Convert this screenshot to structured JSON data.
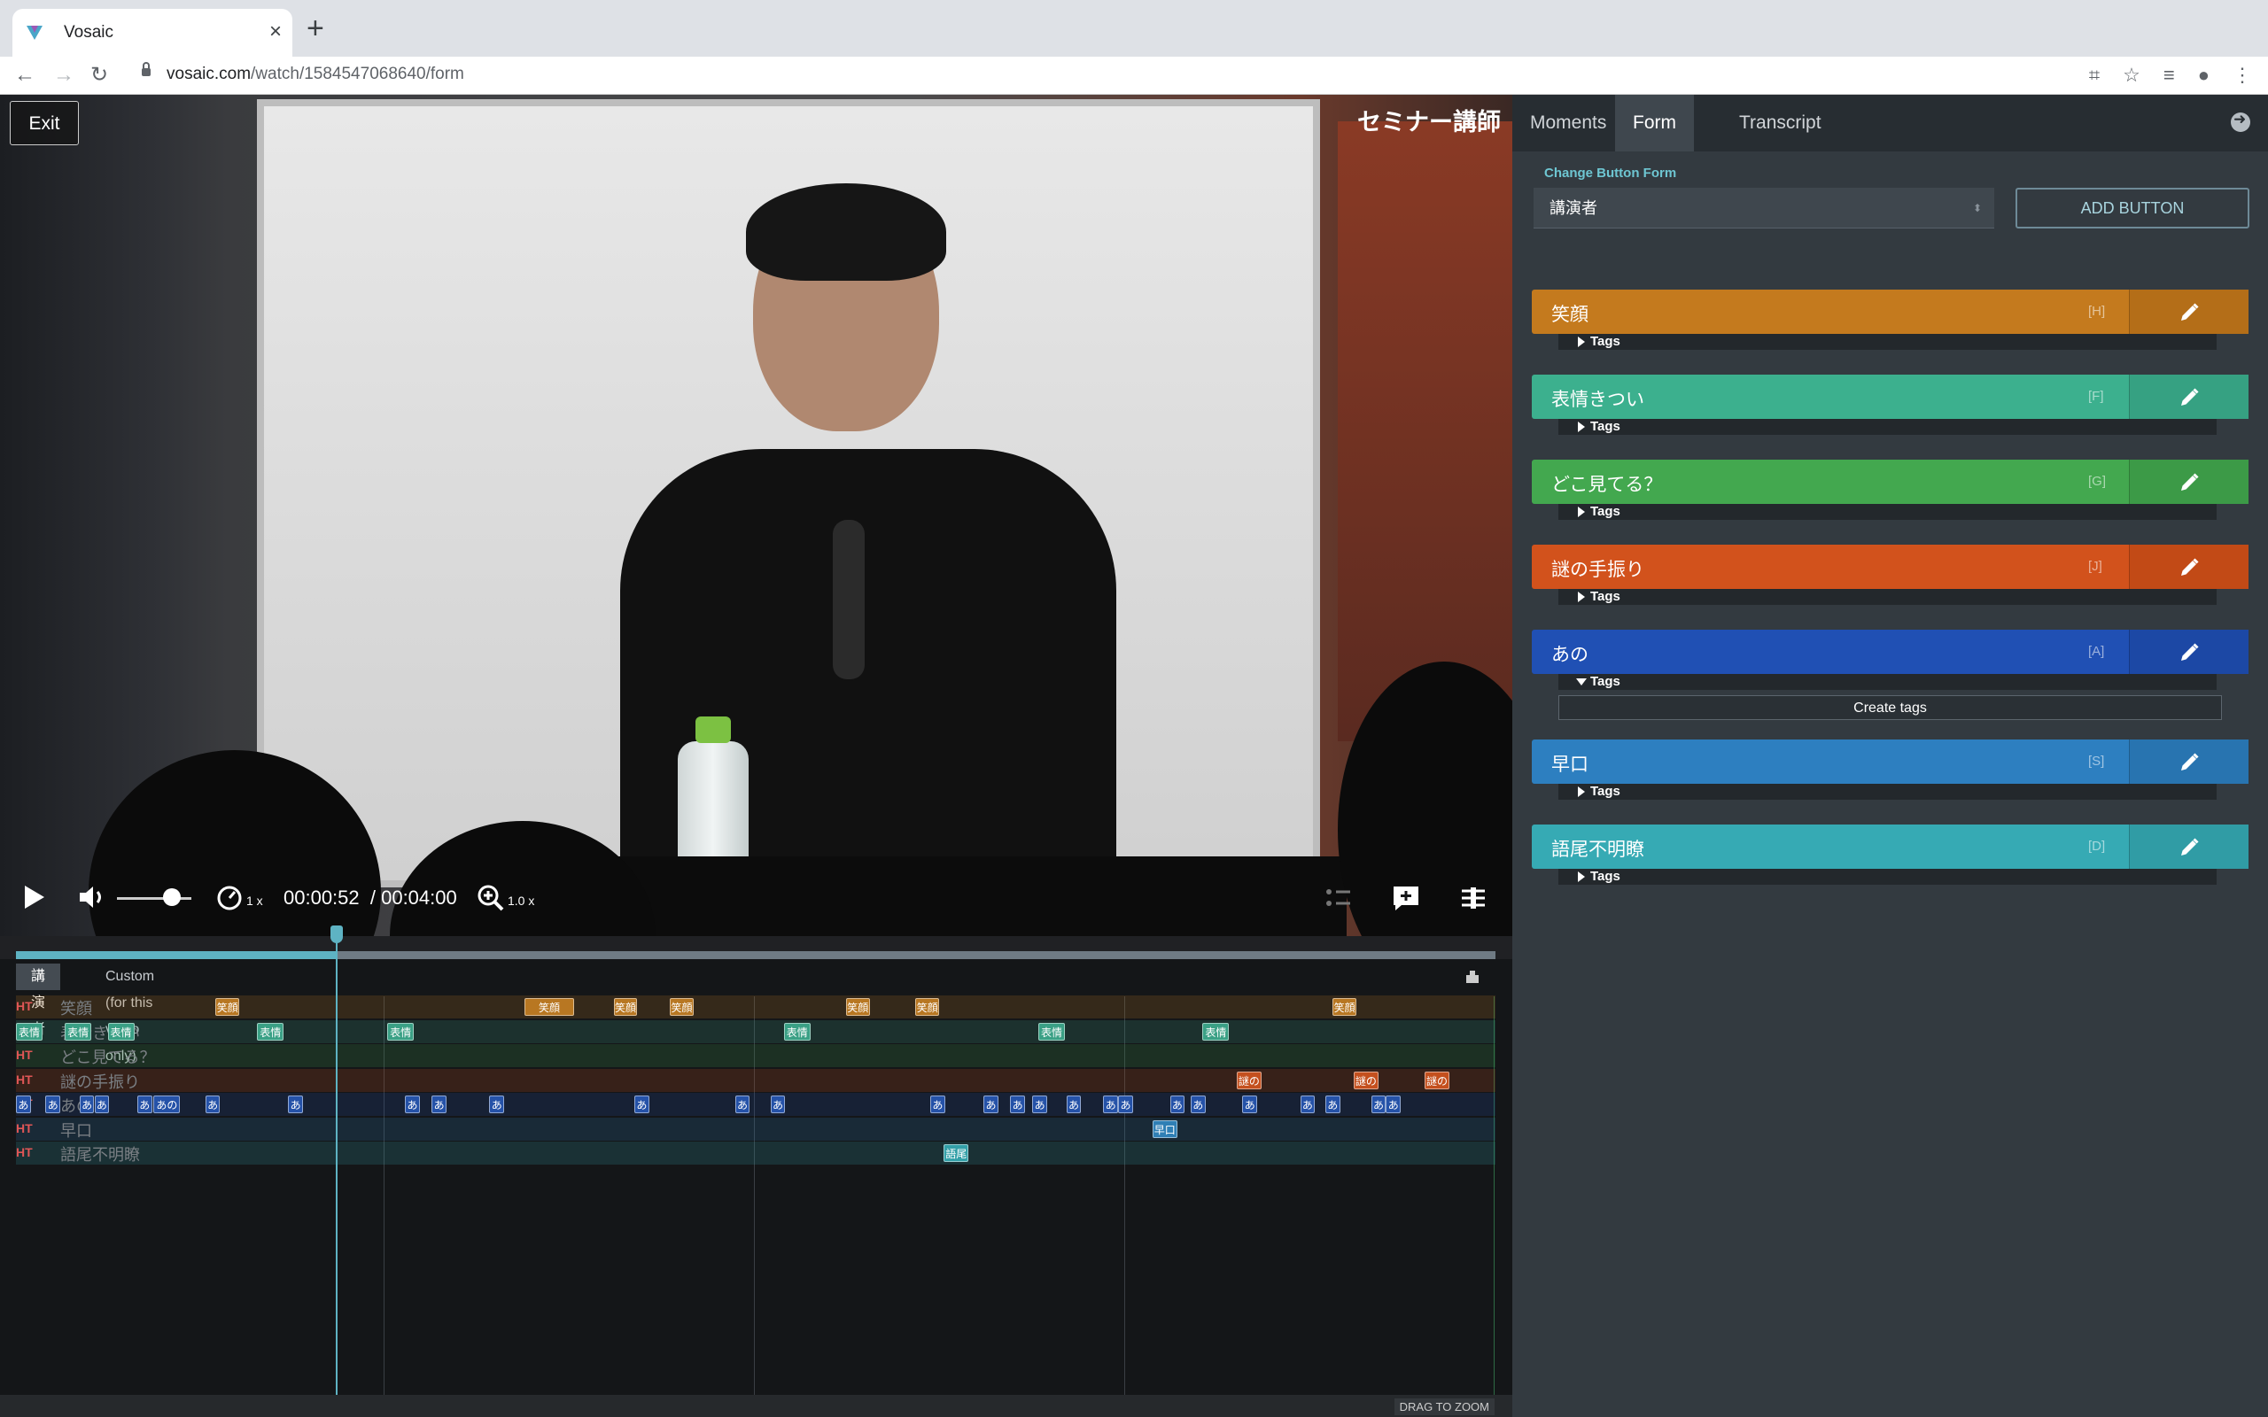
{
  "browser": {
    "tab_title": "Vosaic",
    "url_host": "vosaic.com",
    "url_path": "/watch/1584547068640/form"
  },
  "video": {
    "exit_label": "Exit",
    "overlay_title": "セミナー講師",
    "current_time": "00:00:52",
    "total_time": "/ 00:04:00",
    "rate_label": "1 x",
    "zoom_label": "1.0 x",
    "progress_fraction": 0.217,
    "volume_fraction": 0.62
  },
  "timeline": {
    "tab_selected": "講演者",
    "tab_other": "Custom (for this video only)",
    "drag_to_zoom": "DRAG TO ZOOM",
    "rows": [
      {
        "ht": "HT",
        "name": "笑顔",
        "color": "#b87722",
        "events": [
          {
            "x": 0.135,
            "w": 0.016,
            "t": "笑顔"
          },
          {
            "x": 0.344,
            "w": 0.033,
            "t": "笑顔"
          },
          {
            "x": 0.404,
            "w": 0.016,
            "t": "笑顔"
          },
          {
            "x": 0.442,
            "w": 0.016,
            "t": "笑顔"
          },
          {
            "x": 0.561,
            "w": 0.016,
            "t": "笑顔"
          },
          {
            "x": 0.608,
            "w": 0.016,
            "t": "笑顔"
          },
          {
            "x": 0.89,
            "w": 0.016,
            "t": "笑顔"
          }
        ]
      },
      {
        "ht": "HT",
        "name": "表情きつい",
        "color": "#3aa085",
        "events": [
          {
            "x": 0.0,
            "w": 0.018,
            "t": "表情"
          },
          {
            "x": 0.033,
            "w": 0.018,
            "t": "表情"
          },
          {
            "x": 0.062,
            "w": 0.018,
            "t": "表情"
          },
          {
            "x": 0.163,
            "w": 0.018,
            "t": "表情"
          },
          {
            "x": 0.251,
            "w": 0.018,
            "t": "表情"
          },
          {
            "x": 0.519,
            "w": 0.018,
            "t": "表情"
          },
          {
            "x": 0.691,
            "w": 0.018,
            "t": "表情"
          },
          {
            "x": 0.802,
            "w": 0.018,
            "t": "表情"
          }
        ]
      },
      {
        "ht": "HT",
        "name": "どこ見てる？",
        "color": "#3e9a4e",
        "events": []
      },
      {
        "ht": "HT",
        "name": "謎の手振り",
        "color": "#c4501e",
        "events": [
          {
            "x": 0.825,
            "w": 0.017,
            "t": "謎の"
          },
          {
            "x": 0.904,
            "w": 0.017,
            "t": "謎の"
          },
          {
            "x": 0.952,
            "w": 0.017,
            "t": "謎の"
          }
        ]
      },
      {
        "ht": "HT",
        "name": "あの",
        "color": "#2552a8",
        "events": [
          {
            "x": 0.0,
            "w": 0.01,
            "t": "あの"
          },
          {
            "x": 0.02,
            "w": 0.01,
            "t": "あの"
          },
          {
            "x": 0.043,
            "w": 0.01,
            "t": "あの"
          },
          {
            "x": 0.053,
            "w": 0.01,
            "t": "あの"
          },
          {
            "x": 0.082,
            "w": 0.01,
            "t": "あの"
          },
          {
            "x": 0.093,
            "w": 0.018,
            "t": "あの"
          },
          {
            "x": 0.128,
            "w": 0.01,
            "t": "あの"
          },
          {
            "x": 0.184,
            "w": 0.01,
            "t": "あの"
          },
          {
            "x": 0.263,
            "w": 0.01,
            "t": "あの"
          },
          {
            "x": 0.281,
            "w": 0.01,
            "t": "あの"
          },
          {
            "x": 0.32,
            "w": 0.01,
            "t": "あの"
          },
          {
            "x": 0.418,
            "w": 0.01,
            "t": "あの"
          },
          {
            "x": 0.486,
            "w": 0.01,
            "t": "あの"
          },
          {
            "x": 0.51,
            "w": 0.01,
            "t": "あの"
          },
          {
            "x": 0.618,
            "w": 0.01,
            "t": "あの"
          },
          {
            "x": 0.654,
            "w": 0.01,
            "t": "あの"
          },
          {
            "x": 0.672,
            "w": 0.01,
            "t": "あの"
          },
          {
            "x": 0.687,
            "w": 0.01,
            "t": "あの"
          },
          {
            "x": 0.71,
            "w": 0.01,
            "t": "あの"
          },
          {
            "x": 0.735,
            "w": 0.01,
            "t": "あの"
          },
          {
            "x": 0.745,
            "w": 0.01,
            "t": "あの"
          },
          {
            "x": 0.78,
            "w": 0.01,
            "t": "あの"
          },
          {
            "x": 0.794,
            "w": 0.01,
            "t": "あの"
          },
          {
            "x": 0.829,
            "w": 0.01,
            "t": "あの"
          },
          {
            "x": 0.868,
            "w": 0.01,
            "t": "あの"
          },
          {
            "x": 0.885,
            "w": 0.01,
            "t": "あの"
          },
          {
            "x": 0.916,
            "w": 0.01,
            "t": "あの"
          },
          {
            "x": 0.926,
            "w": 0.01,
            "t": "あの"
          }
        ]
      },
      {
        "ht": "HT",
        "name": "早口",
        "color": "#2f7fb5",
        "events": [
          {
            "x": 0.768,
            "w": 0.017,
            "t": "早口"
          }
        ]
      },
      {
        "ht": "HT",
        "name": "語尾不明瞭",
        "color": "#33a0a8",
        "events": [
          {
            "x": 0.627,
            "w": 0.017,
            "t": "語尾"
          }
        ]
      }
    ]
  },
  "panel": {
    "tabs": [
      "Moments",
      "Form",
      "Transcript"
    ],
    "selected_tab": "Form",
    "change_form_label": "Change Button Form",
    "form_select_value": "講演者",
    "add_button_label": "ADD BUTTON",
    "tags_label": "Tags",
    "create_tags_label": "Create tags",
    "buttons": [
      {
        "label": "笑顔",
        "key": "[H]",
        "color": "#c47a1e",
        "edit_color": "#b46e18",
        "expanded": false
      },
      {
        "label": "表情きつい",
        "key": "[F]",
        "color": "#3cb08e",
        "edit_color": "#36a182",
        "expanded": false
      },
      {
        "label": "どこ見てる？",
        "key": "[G]",
        "color": "#43a84f",
        "edit_color": "#3c9a47",
        "expanded": false
      },
      {
        "label": "謎の手振り",
        "key": "[J]",
        "color": "#d2521c",
        "edit_color": "#c24a16",
        "expanded": false
      },
      {
        "label": "あの",
        "key": "[A]",
        "color": "#2050b4",
        "edit_color": "#1c48a5",
        "expanded": true
      },
      {
        "label": "早口",
        "key": "[S]",
        "color": "#2d7fc0",
        "edit_color": "#2874b0",
        "expanded": false
      },
      {
        "label": "語尾不明瞭",
        "key": "[D]",
        "color": "#36aab4",
        "edit_color": "#309ca5",
        "expanded": false
      }
    ]
  }
}
